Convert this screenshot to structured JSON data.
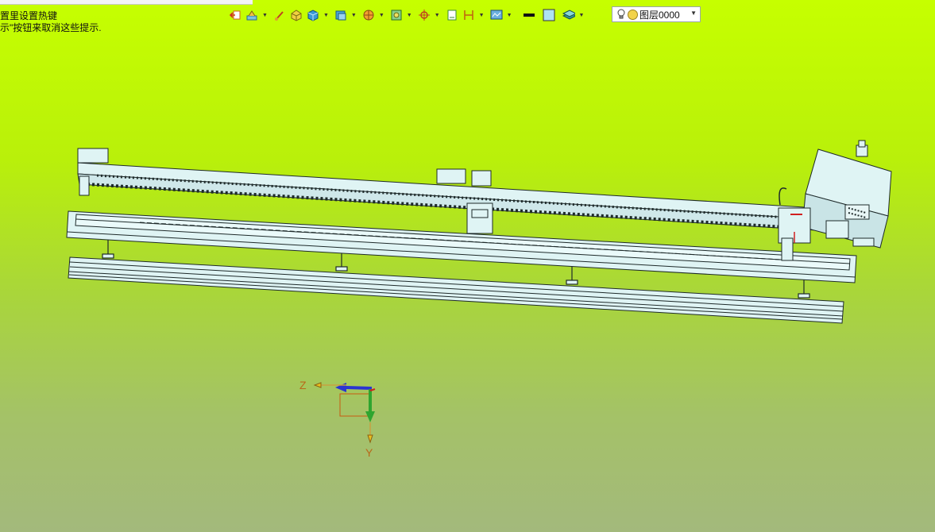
{
  "title_strip": "",
  "hints": {
    "line1": "置里设置热键",
    "line2": "示\"按钮来取消这些提示."
  },
  "toolbar": {
    "icons": [
      "exit-icon",
      "construct-icon",
      "brush-icon",
      "shape-icon",
      "solid-icon",
      "view-cube-icon",
      "render-icon",
      "frame-icon",
      "snap-icon",
      "page-icon",
      "dimension-icon",
      "display-icon",
      "line-color-icon",
      "fill-color-icon",
      "layer-tool-icon"
    ]
  },
  "layer": {
    "value": "图层0000"
  },
  "axes": {
    "z_label": "Z",
    "y_label": "Y"
  },
  "colors": {
    "bg_top": "#c6ff00",
    "bg_bottom": "#a3b97c",
    "part_fill": "#dff4f4",
    "part_stroke": "#1e2a2a",
    "axis_z": "#2a34d0",
    "axis_y": "#2fa52f",
    "axis_label": "#b9691a"
  }
}
